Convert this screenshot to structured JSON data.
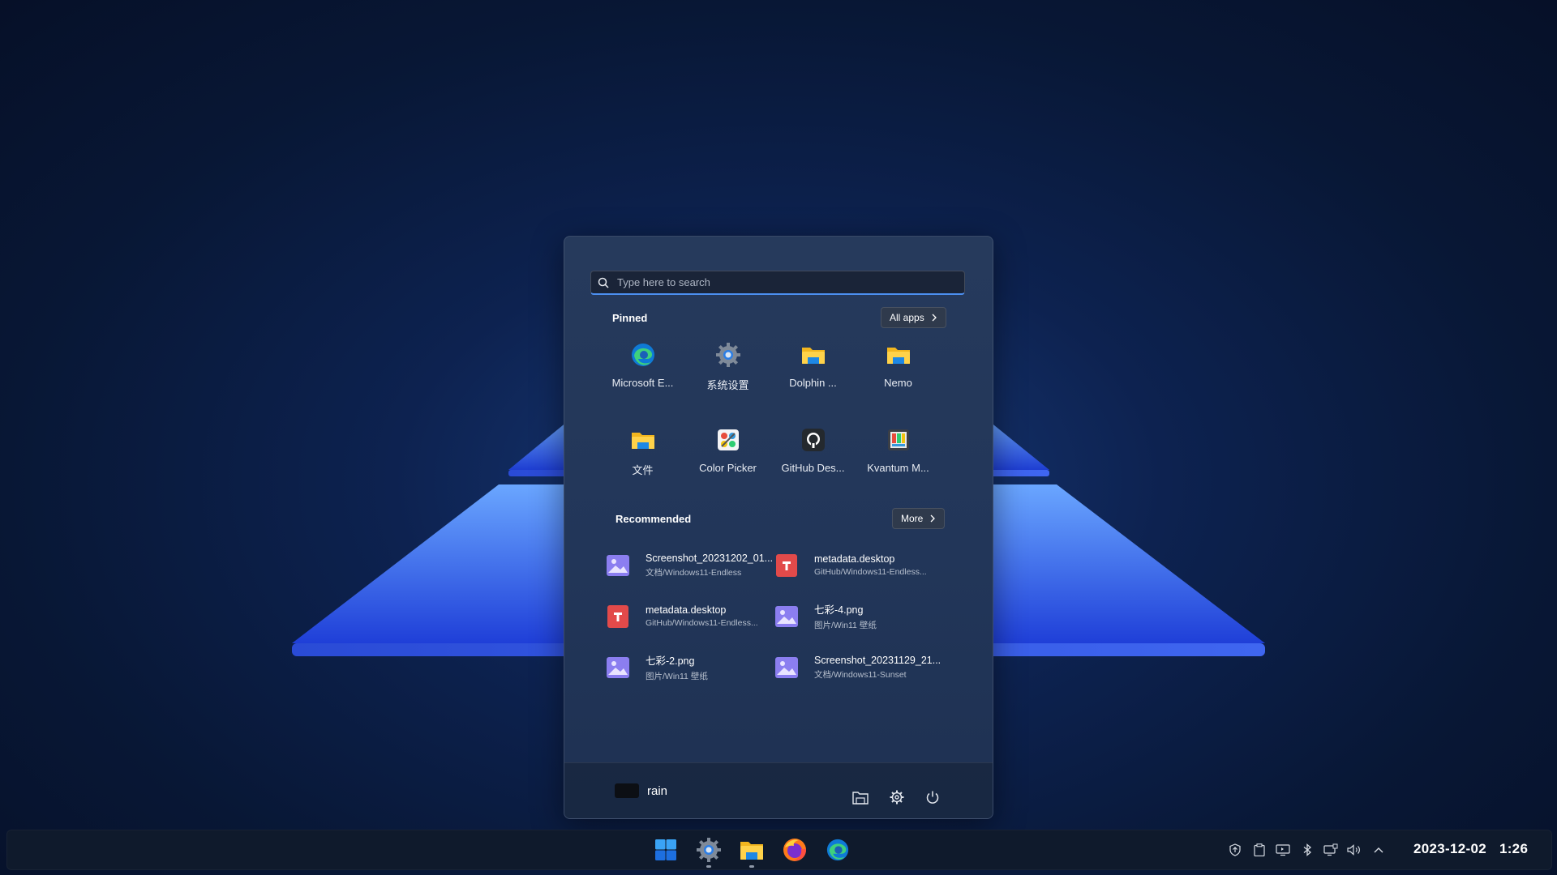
{
  "search": {
    "placeholder": "Type here to search"
  },
  "pinned": {
    "title": "Pinned",
    "all_apps_label": "All apps",
    "apps": [
      {
        "label": "Microsoft E...",
        "icon": "edge-icon"
      },
      {
        "label": "系统设置",
        "icon": "gear-icon"
      },
      {
        "label": "Dolphin ...",
        "icon": "folder-icon"
      },
      {
        "label": "Nemo",
        "icon": "folder-icon"
      },
      {
        "label": "文件",
        "icon": "folder-icon"
      },
      {
        "label": "Color Picker",
        "icon": "color-picker-icon"
      },
      {
        "label": "GitHub Des...",
        "icon": "github-icon"
      },
      {
        "label": "Kvantum M...",
        "icon": "kvantum-icon"
      }
    ]
  },
  "recommended": {
    "title": "Recommended",
    "more_label": "More",
    "items": [
      {
        "name": "Screenshot_20231202_01...",
        "path": "文档/Windows11-Endless",
        "icon": "image-file-icon"
      },
      {
        "name": "metadata.desktop",
        "path": "GitHub/Windows11-Endless...",
        "icon": "text-file-icon"
      },
      {
        "name": "metadata.desktop",
        "path": "GitHub/Windows11-Endless...",
        "icon": "text-file-icon"
      },
      {
        "name": "七彩-4.png",
        "path": "图片/Win11 壁纸",
        "icon": "image-file-icon"
      },
      {
        "name": "七彩-2.png",
        "path": "图片/Win11 壁纸",
        "icon": "image-file-icon"
      },
      {
        "name": "Screenshot_20231129_21...",
        "path": "文档/Windows11-Sunset",
        "icon": "image-file-icon"
      }
    ]
  },
  "footer": {
    "username": "rain"
  },
  "taskbar": {
    "apps": [
      "start-icon",
      "settings-icon",
      "file-manager-icon",
      "firefox-icon",
      "edge-icon"
    ],
    "date": "2023-12-02",
    "time": "1:26"
  },
  "colors": {
    "accent": "#4c8ff0",
    "panel": "#223659",
    "taskbar": "#0f1a2c"
  }
}
